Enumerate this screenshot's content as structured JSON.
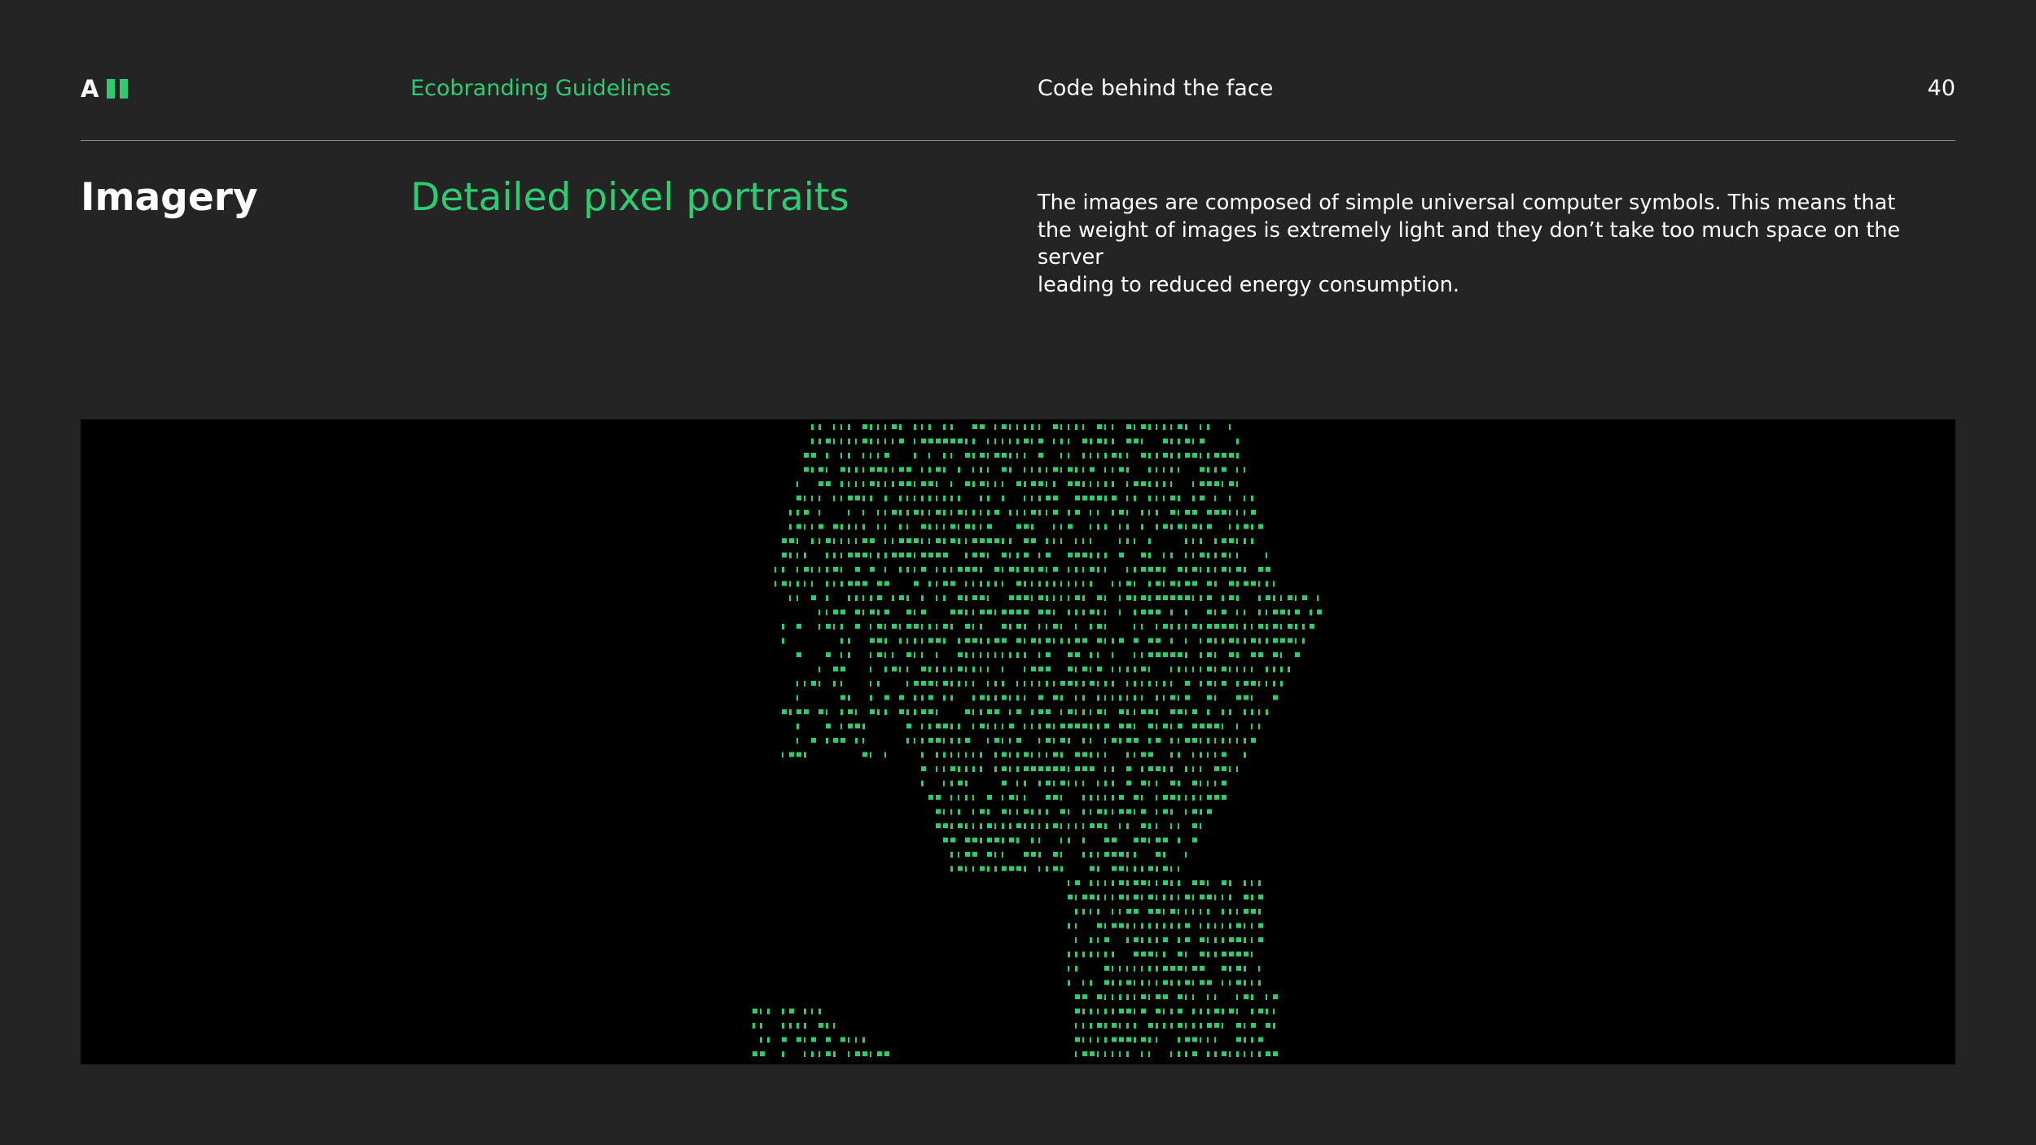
{
  "header": {
    "logo_letter": "A",
    "brand": "Ecobranding Guidelines",
    "section": "Code behind the face",
    "page_number": "40"
  },
  "content": {
    "title": "Imagery",
    "subtitle": "Detailed pixel portraits",
    "description_lines": [
      "The images are composed of simple universal computer symbols. This means that",
      "the weight of images is extremely light and they don’t take too much space on the server",
      "leading to reduced energy consumption."
    ]
  },
  "image": {
    "icon": "ascii-portrait-image",
    "glyph_color": "#2ecc71",
    "background": "#000000"
  },
  "colors": {
    "accent": "#2ecc71",
    "page_background": "#242424",
    "text": "#ffffff",
    "rule": "#8a8a8a"
  }
}
